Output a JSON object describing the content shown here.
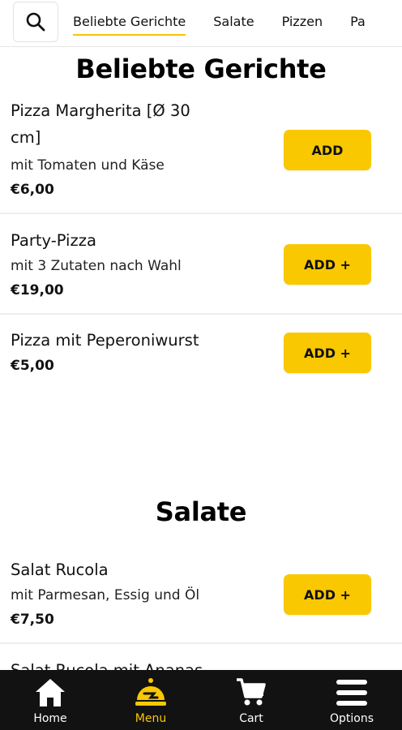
{
  "header": {
    "tabs": [
      {
        "label": "Beliebte Gerichte",
        "active": true
      },
      {
        "label": "Salate",
        "active": false
      },
      {
        "label": "Pizzen",
        "active": false
      },
      {
        "label": "Pa",
        "active": false
      }
    ],
    "search_icon": "search-icon"
  },
  "sections": [
    {
      "title": "Beliebte Gerichte",
      "items": [
        {
          "name_line1": "Pizza Margherita [Ø 30",
          "name_line2": "cm]",
          "description": "mit Tomaten und Käse",
          "price": "€6,00",
          "button": "ADD"
        },
        {
          "name": "Party-Pizza",
          "description": "mit 3 Zutaten nach Wahl",
          "price": "€19,00",
          "button": "ADD +"
        },
        {
          "name": "Pizza mit Peperoniwurst",
          "price": "€5,00",
          "button": "ADD +"
        }
      ]
    },
    {
      "title": "Salate",
      "items": [
        {
          "name": "Salat Rucola",
          "description": "mit Parmesan, Essig und Öl",
          "price": "€7,50",
          "button": "ADD +"
        },
        {
          "name": "Salat Rucola mit Ananas"
        }
      ]
    }
  ],
  "bottom_nav": [
    {
      "label": "Home",
      "icon": "home-icon",
      "active": false
    },
    {
      "label": "Menu",
      "icon": "menu-food-icon",
      "active": true
    },
    {
      "label": "Cart",
      "icon": "cart-icon",
      "active": false
    },
    {
      "label": "Options",
      "icon": "hamburger-icon",
      "active": false
    }
  ],
  "colors": {
    "accent": "#f9c800",
    "nav_bg": "#121212"
  }
}
